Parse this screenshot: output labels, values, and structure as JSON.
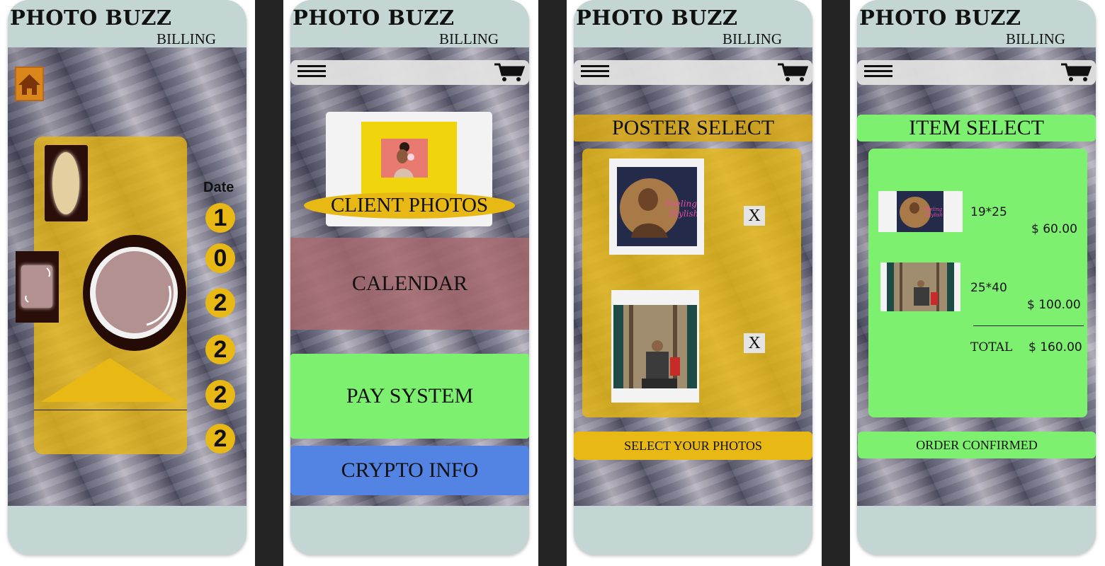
{
  "app": {
    "title": "PHOTO BUZZ",
    "subtitle": "BILLING"
  },
  "icons": {
    "home": "home-icon",
    "menu": "menu-icon",
    "cart": "cart-icon"
  },
  "colors": {
    "header": "#c3d6d3",
    "gold": "#e8b814",
    "green": "#7ef070",
    "rose": "#a66a6f",
    "blue": "#5383e3",
    "separator": "#232323"
  },
  "screen1": {
    "date_label": "Date",
    "date_digits": [
      "1",
      "0",
      "2",
      "2",
      "2",
      "2"
    ]
  },
  "screen2": {
    "client_photos": "CLIENT PHOTOS",
    "calendar": "CALENDAR",
    "pay_system": "PAY SYSTEM",
    "crypto_info": "CRYPTO INFO"
  },
  "screen3": {
    "heading": "POSTER SELECT",
    "remove_label": "X",
    "select_button": "SELECT YOUR PHOTOS"
  },
  "screen4": {
    "heading": "ITEM SELECT",
    "items": [
      {
        "size": "19*25",
        "price": "$ 60.00"
      },
      {
        "size": "25*40",
        "price": "$ 100.00"
      }
    ],
    "total_label": "TOTAL",
    "total_value": "$ 160.00",
    "confirm_button": "ORDER CONFIRMED"
  }
}
